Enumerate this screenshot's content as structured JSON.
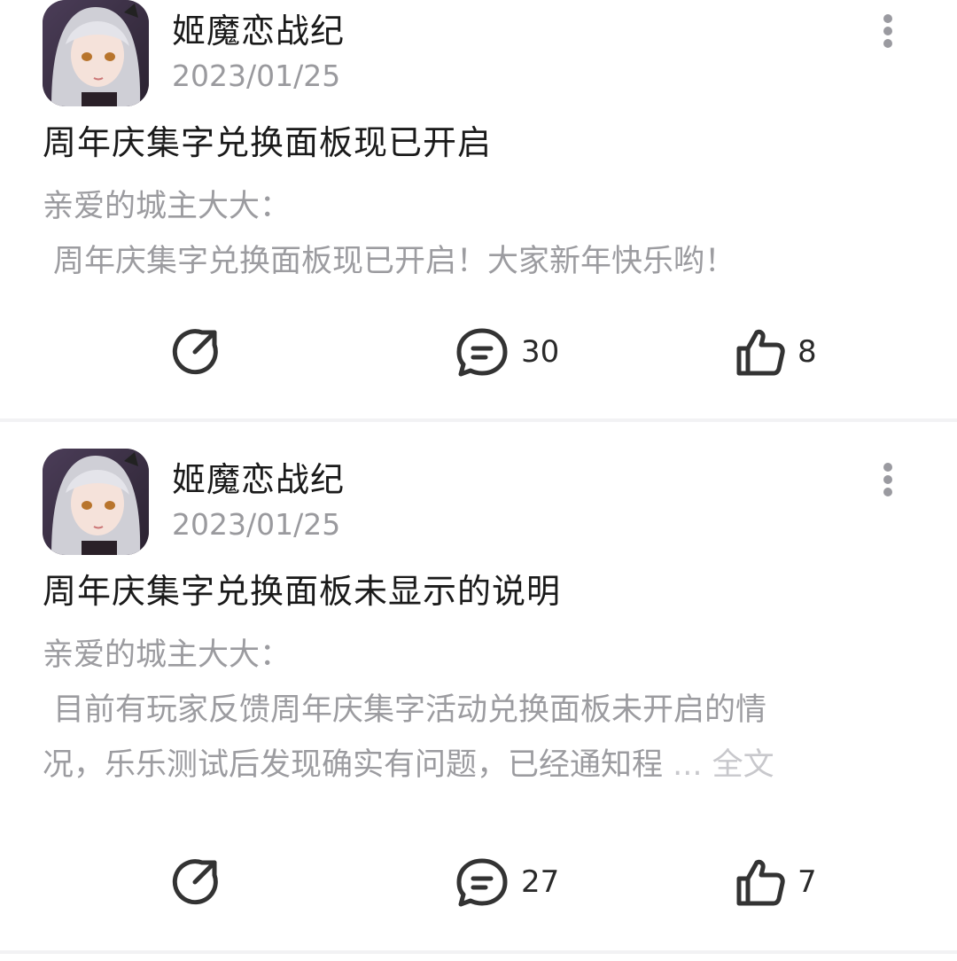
{
  "posts": [
    {
      "author": "姬魔恋战纪",
      "date": "2023/01/25",
      "title": "周年庆集字兑换面板现已开启",
      "body_lines": [
        "亲爱的城主大大：",
        "周年庆集字兑换面板现已开启！大家新年快乐哟！"
      ],
      "comments": "30",
      "likes": "8"
    },
    {
      "author": "姬魔恋战纪",
      "date": "2023/01/25",
      "title": "周年庆集字兑换面板未显示的说明",
      "body_lines": [
        "亲爱的城主大大：",
        "目前有玩家反馈周年庆集字活动兑换面板未开启的情",
        "况，乐乐测试后发现确实有问题，已经通知程"
      ],
      "more_label": "... 全文",
      "comments": "27",
      "likes": "7"
    }
  ],
  "icons": {
    "share": "share-icon",
    "comment": "comment-icon",
    "like": "thumbs-up-icon",
    "more": "more-vertical-icon"
  }
}
